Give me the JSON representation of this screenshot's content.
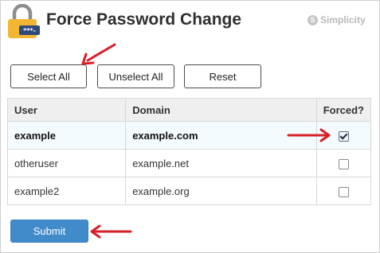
{
  "header": {
    "title": "Force Password Change",
    "brand": "Simplicity",
    "lock_code": "***-"
  },
  "toolbar": {
    "select_all": "Select All",
    "unselect_all": "Unselect All",
    "reset": "Reset"
  },
  "table": {
    "headers": {
      "user": "User",
      "domain": "Domain",
      "forced": "Forced?"
    },
    "rows": [
      {
        "user": "example",
        "domain": "example.com",
        "forced": true
      },
      {
        "user": "otheruser",
        "domain": "example.net",
        "forced": false
      },
      {
        "user": "example2",
        "domain": "example.org",
        "forced": false
      }
    ]
  },
  "actions": {
    "submit": "Submit"
  },
  "colors": {
    "accent": "#428bca",
    "arrow": "#d62027",
    "lock_body": "#f2b632",
    "lock_panel": "#2d4a7c"
  }
}
